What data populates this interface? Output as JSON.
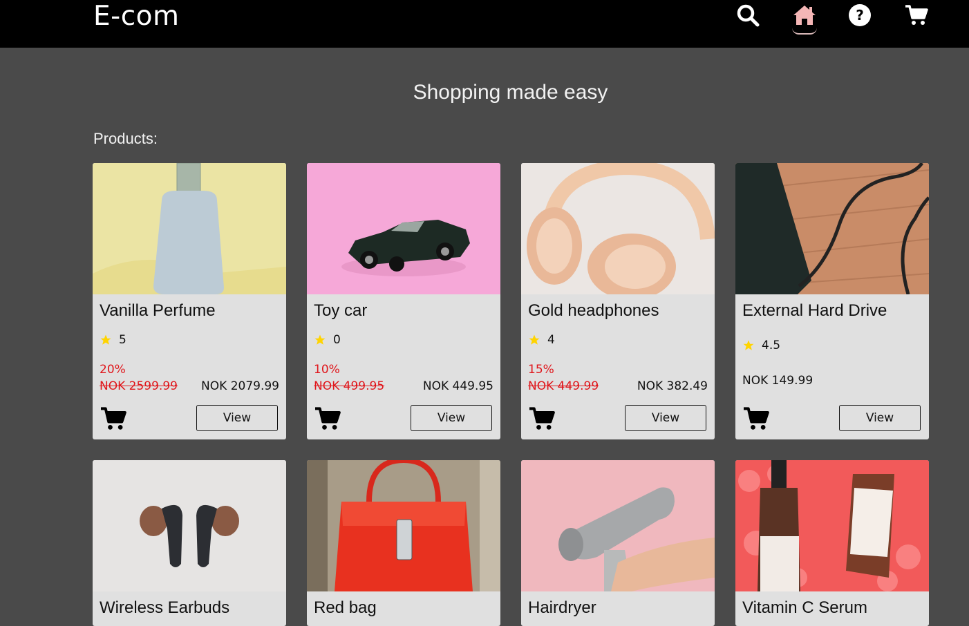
{
  "header": {
    "logo": "E-com",
    "nav": [
      "search-icon",
      "home-icon",
      "help-icon",
      "cart-icon"
    ],
    "active_color": "#f4b6b6"
  },
  "hero": {
    "title": "Shopping made easy"
  },
  "products_label": "Products:",
  "products": [
    {
      "name": "Vanilla Perfume",
      "rating": "5",
      "discount": "20%",
      "old_price": "NOK 2599.99",
      "price": "NOK 2079.99",
      "view_label": "View"
    },
    {
      "name": "Toy car",
      "rating": "0",
      "discount": "10%",
      "old_price": "NOK 499.95",
      "price": "NOK 449.95",
      "view_label": "View"
    },
    {
      "name": "Gold headphones",
      "rating": "4",
      "discount": "15%",
      "old_price": "NOK 449.99",
      "price": "NOK 382.49",
      "view_label": "View"
    },
    {
      "name": "External Hard Drive",
      "rating": "4.5",
      "price": "NOK 149.99",
      "view_label": "View"
    },
    {
      "name": "Wireless Earbuds"
    },
    {
      "name": "Red bag"
    },
    {
      "name": "Hairdryer"
    },
    {
      "name": "Vitamin C Serum"
    }
  ],
  "colors": {
    "discount": "#e0161b",
    "star": "#ffd400",
    "background": "#4a4a4a",
    "card": "#e0e0e0"
  }
}
